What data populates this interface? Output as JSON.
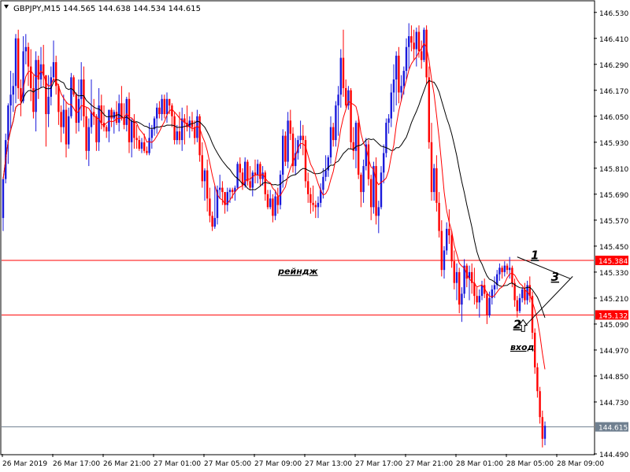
{
  "header": {
    "symbol": "GBPJPY,M15",
    "ohlc": "144.565 144.638 144.534 144.615"
  },
  "chart_data": {
    "type": "candlestick",
    "ylim": [
      144.49,
      146.58
    ],
    "y_ticks": [
      "146.530",
      "146.410",
      "146.290",
      "146.170",
      "146.050",
      "145.930",
      "145.810",
      "145.690",
      "145.570",
      "145.450",
      "145.330",
      "145.210",
      "145.090",
      "144.970",
      "144.850",
      "144.730",
      "144.490"
    ],
    "x_ticks": [
      "26 Mar 2019",
      "26 Mar 17:00",
      "26 Mar 21:00",
      "27 Mar 01:00",
      "27 Mar 05:00",
      "27 Mar 09:00",
      "27 Mar 13:00",
      "27 Mar 17:00",
      "27 Mar 21:00",
      "28 Mar 01:00",
      "28 Mar 05:00",
      "28 Mar 09:00"
    ],
    "levels": [
      {
        "value": 145.384,
        "label": "145.384",
        "color": "#ff0000"
      },
      {
        "value": 145.132,
        "label": "145.132",
        "color": "#ff0000"
      },
      {
        "value": 144.615,
        "label": "144.615",
        "color": "#708090"
      }
    ],
    "annotations": [
      {
        "text": "рейндж",
        "bar": 117,
        "price": 145.32
      },
      {
        "text": "вход",
        "bar": 206,
        "price": 144.97
      },
      {
        "text": "1",
        "bar": 211,
        "price": 145.39
      },
      {
        "text": "2",
        "bar": 204,
        "price": 145.07
      },
      {
        "text": "3",
        "bar": 219,
        "price": 145.29
      }
    ],
    "trendlines": [
      {
        "from": [
          204,
          145.4
        ],
        "to": [
          225,
          145.3
        ]
      },
      {
        "from": [
          207,
          145.08
        ],
        "to": [
          226,
          145.31
        ]
      }
    ],
    "candles": [
      [
        145.58,
        145.77,
        145.52,
        145.76
      ],
      [
        145.76,
        145.97,
        145.74,
        145.94
      ],
      [
        145.94,
        146.11,
        145.83,
        146.1
      ],
      [
        146.1,
        146.26,
        145.98,
        146.15
      ],
      [
        146.15,
        146.25,
        146.07,
        146.19
      ],
      [
        146.19,
        146.43,
        146.11,
        146.41
      ],
      [
        146.41,
        146.45,
        146.13,
        146.18
      ],
      [
        146.18,
        146.22,
        146.05,
        146.12
      ],
      [
        146.12,
        146.42,
        146.11,
        146.35
      ],
      [
        146.35,
        146.43,
        146.29,
        146.37
      ],
      [
        146.37,
        146.39,
        146.19,
        146.28
      ],
      [
        146.28,
        146.36,
        146.12,
        146.18
      ],
      [
        146.18,
        146.24,
        146.04,
        146.07
      ],
      [
        146.07,
        146.35,
        145.98,
        146.31
      ],
      [
        146.31,
        146.33,
        146.13,
        146.22
      ],
      [
        146.22,
        146.37,
        146.18,
        146.29
      ],
      [
        146.29,
        146.38,
        146.19,
        146.24
      ],
      [
        146.24,
        146.24,
        145.91,
        146.06
      ],
      [
        146.06,
        146.24,
        146.0,
        146.14
      ],
      [
        146.14,
        146.28,
        146.1,
        146.23
      ],
      [
        146.23,
        146.4,
        146.21,
        146.3
      ],
      [
        146.3,
        146.33,
        146.15,
        146.19
      ],
      [
        146.19,
        146.2,
        146.01,
        146.07
      ],
      [
        146.07,
        146.1,
        145.93,
        146.0
      ],
      [
        146.0,
        146.15,
        145.97,
        146.08
      ],
      [
        146.08,
        146.12,
        145.86,
        145.92
      ],
      [
        145.92,
        146.09,
        145.9,
        146.05
      ],
      [
        146.05,
        146.25,
        146.04,
        146.23
      ],
      [
        146.23,
        146.24,
        146.14,
        146.15
      ],
      [
        146.15,
        146.16,
        145.97,
        146.02
      ],
      [
        146.02,
        146.22,
        145.98,
        146.13
      ],
      [
        146.13,
        146.3,
        146.03,
        146.22
      ],
      [
        146.22,
        146.28,
        146.0,
        146.05
      ],
      [
        146.05,
        146.09,
        145.85,
        145.89
      ],
      [
        145.89,
        146.04,
        145.82,
        146.0
      ],
      [
        146.0,
        146.22,
        145.97,
        146.07
      ],
      [
        146.07,
        146.13,
        146.01,
        146.05
      ],
      [
        146.05,
        146.06,
        145.89,
        145.93
      ],
      [
        145.93,
        146.18,
        145.89,
        146.1
      ],
      [
        146.1,
        146.15,
        145.99,
        146.02
      ],
      [
        146.02,
        146.1,
        145.98,
        146.0
      ],
      [
        146.0,
        146.01,
        145.95,
        145.98
      ],
      [
        145.98,
        146.08,
        145.93,
        146.08
      ],
      [
        146.08,
        146.09,
        146.0,
        146.04
      ],
      [
        146.04,
        146.08,
        145.97,
        146.07
      ],
      [
        146.07,
        146.12,
        146.01,
        146.02
      ],
      [
        146.02,
        146.15,
        145.98,
        146.11
      ],
      [
        146.11,
        146.19,
        146.03,
        146.04
      ],
      [
        146.04,
        146.11,
        145.99,
        146.01
      ],
      [
        146.01,
        146.14,
        145.98,
        146.13
      ],
      [
        146.13,
        146.16,
        145.88,
        145.93
      ],
      [
        145.93,
        146.04,
        145.86,
        146.03
      ],
      [
        146.03,
        146.06,
        145.9,
        145.95
      ],
      [
        145.95,
        146.01,
        145.9,
        145.94
      ],
      [
        145.94,
        145.96,
        145.89,
        145.9
      ],
      [
        145.9,
        145.95,
        145.88,
        145.93
      ],
      [
        145.93,
        145.97,
        145.88,
        145.89
      ],
      [
        145.89,
        145.91,
        145.87,
        145.88
      ],
      [
        145.88,
        146.02,
        145.87,
        145.95
      ],
      [
        145.95,
        146.01,
        145.9,
        145.99
      ],
      [
        145.99,
        146.05,
        145.96,
        146.04
      ],
      [
        146.04,
        146.11,
        145.97,
        146.09
      ],
      [
        146.09,
        146.12,
        146.04,
        146.06
      ],
      [
        146.06,
        146.15,
        146.03,
        146.13
      ],
      [
        146.13,
        146.15,
        146.04,
        146.06
      ],
      [
        146.06,
        146.16,
        146.02,
        146.13
      ],
      [
        146.13,
        146.13,
        146.06,
        146.1
      ],
      [
        146.1,
        146.11,
        146.0,
        146.05
      ],
      [
        146.05,
        146.07,
        145.92,
        145.94
      ],
      [
        145.94,
        146.01,
        145.92,
        145.98
      ],
      [
        145.98,
        146.07,
        145.92,
        145.94
      ],
      [
        145.94,
        146.09,
        145.89,
        146.04
      ],
      [
        146.04,
        146.06,
        145.92,
        146.02
      ],
      [
        146.02,
        146.1,
        145.98,
        146.0
      ],
      [
        146.0,
        146.05,
        145.95,
        146.03
      ],
      [
        146.03,
        146.07,
        145.98,
        146.0
      ],
      [
        146.0,
        146.03,
        145.92,
        145.95
      ],
      [
        145.95,
        146.08,
        145.93,
        146.05
      ],
      [
        146.05,
        146.06,
        145.84,
        145.87
      ],
      [
        145.87,
        145.93,
        145.72,
        145.75
      ],
      [
        145.75,
        145.81,
        145.66,
        145.8
      ],
      [
        145.8,
        145.85,
        145.61,
        145.67
      ],
      [
        145.67,
        145.72,
        145.56,
        145.59
      ],
      [
        145.59,
        145.61,
        145.52,
        145.54
      ],
      [
        145.54,
        145.73,
        145.53,
        145.58
      ],
      [
        145.58,
        145.73,
        145.55,
        145.71
      ],
      [
        145.71,
        145.78,
        145.67,
        145.72
      ],
      [
        145.72,
        145.75,
        145.64,
        145.7
      ],
      [
        145.7,
        145.7,
        145.6,
        145.64
      ],
      [
        145.64,
        145.72,
        145.61,
        145.7
      ],
      [
        145.7,
        145.72,
        145.65,
        145.71
      ],
      [
        145.71,
        145.72,
        145.67,
        145.7
      ],
      [
        145.7,
        145.73,
        145.66,
        145.72
      ],
      [
        145.72,
        145.84,
        145.71,
        145.83
      ],
      [
        145.83,
        145.86,
        145.75,
        145.79
      ],
      [
        145.79,
        145.81,
        145.71,
        145.73
      ],
      [
        145.73,
        145.86,
        145.72,
        145.84
      ],
      [
        145.84,
        145.85,
        145.73,
        145.75
      ],
      [
        145.75,
        145.82,
        145.71,
        145.72
      ],
      [
        145.72,
        145.8,
        145.68,
        145.79
      ],
      [
        145.79,
        145.85,
        145.74,
        145.78
      ],
      [
        145.78,
        145.85,
        145.74,
        145.83
      ],
      [
        145.83,
        145.84,
        145.73,
        145.76
      ],
      [
        145.76,
        145.82,
        145.73,
        145.79
      ],
      [
        145.79,
        145.8,
        145.66,
        145.69
      ],
      [
        145.69,
        145.71,
        145.62,
        145.63
      ],
      [
        145.63,
        145.71,
        145.62,
        145.67
      ],
      [
        145.67,
        145.69,
        145.56,
        145.59
      ],
      [
        145.59,
        145.71,
        145.57,
        145.68
      ],
      [
        145.68,
        145.72,
        145.6,
        145.64
      ],
      [
        145.64,
        145.8,
        145.62,
        145.78
      ],
      [
        145.78,
        145.99,
        145.72,
        145.96
      ],
      [
        145.96,
        145.98,
        145.82,
        145.84
      ],
      [
        145.84,
        146.07,
        145.81,
        146.03
      ],
      [
        146.03,
        146.08,
        145.94,
        145.97
      ],
      [
        145.97,
        146.0,
        145.79,
        145.82
      ],
      [
        145.82,
        145.95,
        145.78,
        145.88
      ],
      [
        145.88,
        145.96,
        145.85,
        145.94
      ],
      [
        145.94,
        146.03,
        145.9,
        145.96
      ],
      [
        145.96,
        146.01,
        145.87,
        145.94
      ],
      [
        145.94,
        145.96,
        145.72,
        145.75
      ],
      [
        145.75,
        145.79,
        145.65,
        145.69
      ],
      [
        145.69,
        145.72,
        145.6,
        145.65
      ],
      [
        145.65,
        145.73,
        145.61,
        145.64
      ],
      [
        145.64,
        145.66,
        145.58,
        145.63
      ],
      [
        145.63,
        145.68,
        145.58,
        145.65
      ],
      [
        145.65,
        145.74,
        145.63,
        145.71
      ],
      [
        145.71,
        145.81,
        145.67,
        145.77
      ],
      [
        145.77,
        145.87,
        145.75,
        145.8
      ],
      [
        145.8,
        145.87,
        145.77,
        145.86
      ],
      [
        145.86,
        146.05,
        145.83,
        146.0
      ],
      [
        146.0,
        146.02,
        145.91,
        145.94
      ],
      [
        145.94,
        146.12,
        145.91,
        146.1
      ],
      [
        146.1,
        146.19,
        145.96,
        146.15
      ],
      [
        146.15,
        146.36,
        146.09,
        146.32
      ],
      [
        146.32,
        146.45,
        146.14,
        146.18
      ],
      [
        146.18,
        146.22,
        146.09,
        146.1
      ],
      [
        146.1,
        146.19,
        146.08,
        146.17
      ],
      [
        146.17,
        146.18,
        145.9,
        145.93
      ],
      [
        145.93,
        146.0,
        145.85,
        145.89
      ],
      [
        145.89,
        146.03,
        145.81,
        146.02
      ],
      [
        146.02,
        146.05,
        145.76,
        145.78
      ],
      [
        145.78,
        145.79,
        145.63,
        145.7
      ],
      [
        145.7,
        145.85,
        145.65,
        145.82
      ],
      [
        145.82,
        145.95,
        145.8,
        145.92
      ],
      [
        145.92,
        145.94,
        145.73,
        145.76
      ],
      [
        145.76,
        145.78,
        145.57,
        145.63
      ],
      [
        145.63,
        145.84,
        145.6,
        145.82
      ],
      [
        145.82,
        145.86,
        145.55,
        145.59
      ],
      [
        145.59,
        145.66,
        145.51,
        145.63
      ],
      [
        145.63,
        145.82,
        145.62,
        145.79
      ],
      [
        145.79,
        145.92,
        145.74,
        145.88
      ],
      [
        145.88,
        146.04,
        145.86,
        146.02
      ],
      [
        146.02,
        146.06,
        145.97,
        146.04
      ],
      [
        146.04,
        146.2,
        146.0,
        146.16
      ],
      [
        146.16,
        146.29,
        146.07,
        146.22
      ],
      [
        146.22,
        146.35,
        146.1,
        146.33
      ],
      [
        146.33,
        146.37,
        146.11,
        146.16
      ],
      [
        146.16,
        146.24,
        146.12,
        146.19
      ],
      [
        146.19,
        146.28,
        146.15,
        146.26
      ],
      [
        146.26,
        146.41,
        146.22,
        146.37
      ],
      [
        146.37,
        146.48,
        146.27,
        146.42
      ],
      [
        146.42,
        146.47,
        146.35,
        146.39
      ],
      [
        146.39,
        146.45,
        146.31,
        146.36
      ],
      [
        146.36,
        146.46,
        146.28,
        146.44
      ],
      [
        146.44,
        146.47,
        146.32,
        146.35
      ],
      [
        146.35,
        146.4,
        146.27,
        146.31
      ],
      [
        146.31,
        146.46,
        146.3,
        146.45
      ],
      [
        146.45,
        146.47,
        146.2,
        146.23
      ],
      [
        146.23,
        146.28,
        145.9,
        145.93
      ],
      [
        145.93,
        146.02,
        145.66,
        145.7
      ],
      [
        145.7,
        145.83,
        145.66,
        145.81
      ],
      [
        145.81,
        145.87,
        145.61,
        145.65
      ],
      [
        145.65,
        145.7,
        145.49,
        145.52
      ],
      [
        145.52,
        145.57,
        145.31,
        145.34
      ],
      [
        145.34,
        145.45,
        145.3,
        145.43
      ],
      [
        145.43,
        145.56,
        145.41,
        145.53
      ],
      [
        145.53,
        145.62,
        145.46,
        145.5
      ],
      [
        145.5,
        145.52,
        145.35,
        145.38
      ],
      [
        145.38,
        145.43,
        145.25,
        145.28
      ],
      [
        145.28,
        145.37,
        145.2,
        145.33
      ],
      [
        145.33,
        145.35,
        145.14,
        145.18
      ],
      [
        145.18,
        145.26,
        145.1,
        145.23
      ],
      [
        145.23,
        145.39,
        145.21,
        145.36
      ],
      [
        145.36,
        145.37,
        145.26,
        145.3
      ],
      [
        145.3,
        145.36,
        145.2,
        145.33
      ],
      [
        145.33,
        145.37,
        145.23,
        145.28
      ],
      [
        145.28,
        145.35,
        145.18,
        145.22
      ],
      [
        145.22,
        145.26,
        145.16,
        145.19
      ],
      [
        145.19,
        145.25,
        145.12,
        145.22
      ],
      [
        145.22,
        145.29,
        145.2,
        145.27
      ],
      [
        145.27,
        145.3,
        145.21,
        145.23
      ],
      [
        145.23,
        145.24,
        145.09,
        145.13
      ],
      [
        145.13,
        145.24,
        145.12,
        145.21
      ],
      [
        145.21,
        145.27,
        145.18,
        145.25
      ],
      [
        145.25,
        145.31,
        145.21,
        145.27
      ],
      [
        145.27,
        145.34,
        145.25,
        145.32
      ],
      [
        145.32,
        145.37,
        145.29,
        145.35
      ],
      [
        145.35,
        145.36,
        145.3,
        145.33
      ],
      [
        145.33,
        145.38,
        145.31,
        145.36
      ],
      [
        145.36,
        145.37,
        145.32,
        145.34
      ],
      [
        145.34,
        145.4,
        145.3,
        145.35
      ],
      [
        145.35,
        145.36,
        145.26,
        145.28
      ],
      [
        145.28,
        145.3,
        145.17,
        145.2
      ],
      [
        145.2,
        145.22,
        145.12,
        145.15
      ],
      [
        145.15,
        145.23,
        145.14,
        145.21
      ],
      [
        145.21,
        145.26,
        145.19,
        145.25
      ],
      [
        145.25,
        145.28,
        145.18,
        145.2
      ],
      [
        145.2,
        145.29,
        145.18,
        145.27
      ],
      [
        145.27,
        145.31,
        145.19,
        145.22
      ],
      [
        145.22,
        145.24,
        145.02,
        145.05
      ],
      [
        145.05,
        145.07,
        144.86,
        144.89
      ],
      [
        144.89,
        144.91,
        144.75,
        144.78
      ],
      [
        144.78,
        144.8,
        144.63,
        144.66
      ],
      [
        144.66,
        144.69,
        144.52,
        144.56
      ],
      [
        144.56,
        144.64,
        144.53,
        144.62
      ]
    ]
  }
}
